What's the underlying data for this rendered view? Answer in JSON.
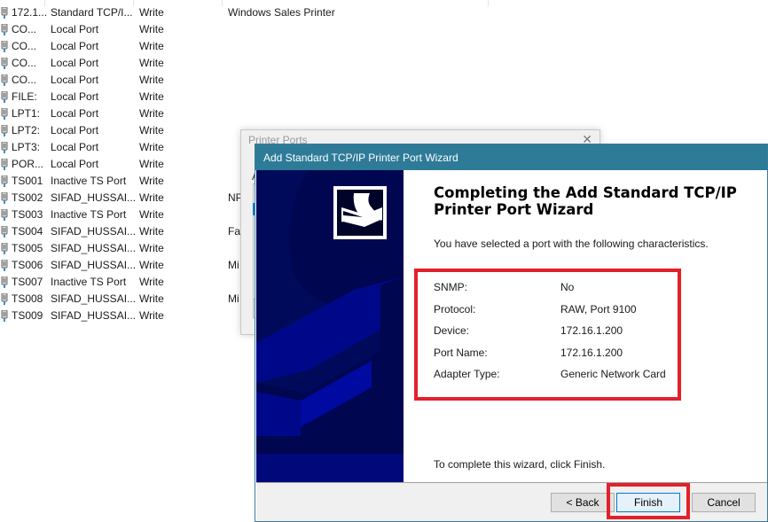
{
  "port_list": {
    "rows": [
      {
        "port": "172.1...",
        "description": "Standard TCP/I...",
        "access": "Write",
        "printer": "Windows Sales Printer"
      },
      {
        "port": "CO...",
        "description": "Local Port",
        "access": "Write",
        "printer": ""
      },
      {
        "port": "CO...",
        "description": "Local Port",
        "access": "Write",
        "printer": ""
      },
      {
        "port": "CO...",
        "description": "Local Port",
        "access": "Write",
        "printer": ""
      },
      {
        "port": "CO...",
        "description": "Local Port",
        "access": "Write",
        "printer": ""
      },
      {
        "port": "FILE:",
        "description": "Local Port",
        "access": "Write",
        "printer": ""
      },
      {
        "port": "LPT1:",
        "description": "Local Port",
        "access": "Write",
        "printer": ""
      },
      {
        "port": "LPT2:",
        "description": "Local Port",
        "access": "Write",
        "printer": ""
      },
      {
        "port": "LPT3:",
        "description": "Local Port",
        "access": "Write",
        "printer": ""
      },
      {
        "port": "POR...",
        "description": "Local Port",
        "access": "Write",
        "printer": ""
      },
      {
        "port": "TS001",
        "description": "Inactive TS Port",
        "access": "Write",
        "printer": ""
      },
      {
        "port": "TS002",
        "description": "SIFAD_HUSSAI...",
        "access": "Write",
        "printer": "NP"
      },
      {
        "port": "TS003",
        "description": "Inactive TS Port",
        "access": "Write",
        "printer": ""
      },
      {
        "port": "TS004",
        "description": "SIFAD_HUSSAI...",
        "access": "Write",
        "printer": "Fax"
      },
      {
        "port": "TS005",
        "description": "SIFAD_HUSSAI...",
        "access": "Write",
        "printer": ""
      },
      {
        "port": "TS006",
        "description": "SIFAD_HUSSAI...",
        "access": "Write",
        "printer": "Mi"
      },
      {
        "port": "TS007",
        "description": "Inactive TS Port",
        "access": "Write",
        "printer": ""
      },
      {
        "port": "TS008",
        "description": "SIFAD_HUSSAI...",
        "access": "Write",
        "printer": "Mi"
      },
      {
        "port": "TS009",
        "description": "SIFAD_HUSSAI...",
        "access": "Write",
        "printer": ""
      }
    ]
  },
  "printer_ports_dialog": {
    "title": "Printer Ports",
    "close_glyph": "✕",
    "label_fragment": "A"
  },
  "wizard": {
    "title": "Add Standard TCP/IP Printer Port Wizard",
    "heading": "Completing the Add Standard TCP/IP Printer Port Wizard",
    "intro": "You have selected a port with the following characteristics.",
    "properties": [
      {
        "label": "SNMP:",
        "value": "No"
      },
      {
        "label": "Protocol:",
        "value": "RAW, Port 9100"
      },
      {
        "label": "Device:",
        "value": "172.16.1.200"
      },
      {
        "label": "Port Name:",
        "value": "172.16.1.200"
      },
      {
        "label": "Adapter Type:",
        "value": "Generic Network Card"
      }
    ],
    "footer_text": "To complete this wizard, click Finish.",
    "buttons": {
      "back": "< Back",
      "finish": "Finish",
      "cancel": "Cancel"
    },
    "colors": {
      "titlebar": "#2e7b98",
      "banner": "#000a5a",
      "highlight": "#e3202a"
    }
  }
}
